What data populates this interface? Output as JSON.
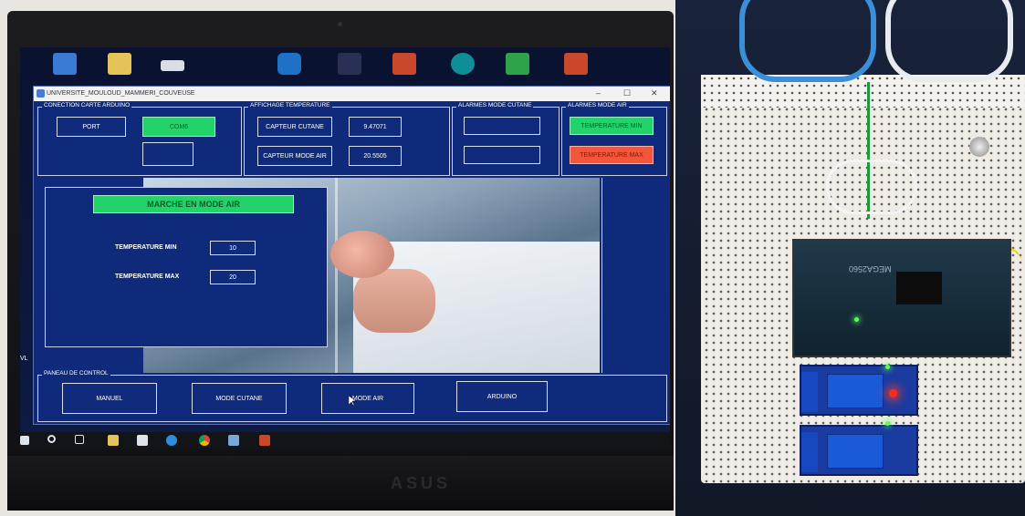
{
  "window": {
    "title": "UNIVERSITE_MOULOUD_MAMMERI_COUVEUSE",
    "minimize": "–",
    "maximize": "☐",
    "close": "✕"
  },
  "connection": {
    "group_title": "CONECTION CARTE ARDUINO",
    "port_label": "PORT",
    "port_value": "COM6",
    "status_value": ""
  },
  "temperature_display": {
    "group_title": "AFFICHAGE TEMPERATURE",
    "skin_sensor_label": "CAPTEUR CUTANE",
    "skin_sensor_value": "9.47071",
    "air_sensor_label": "CAPTEUR MODE AIR",
    "air_sensor_value": "20.5505"
  },
  "alarms_skin": {
    "group_title": "ALARMES MODE CUTANE",
    "field_1": "",
    "field_2": ""
  },
  "alarms_air": {
    "group_title": "ALARMES MODE AIR",
    "temp_min_label": "TEMPERATURE MIN",
    "temp_max_label": "TEMPERATURE MAX"
  },
  "mode_panel": {
    "banner": "MARCHE EN MODE AIR",
    "temp_min_label": "TEMPERATURE MIN",
    "temp_min_value": "10",
    "temp_max_label": "TEMPERATURE MAX",
    "temp_max_value": "20"
  },
  "control_panel": {
    "group_title": "PANEAU DE CONTROL",
    "buttons": [
      "MANUEL",
      "MODE CUTANE",
      "MODE AIR",
      "ARDUINO"
    ]
  },
  "side_label": "VL",
  "laptop_brand": "ASUS",
  "board_labels": {
    "arduino_text": "MEGA2560"
  },
  "colors": {
    "panel_blue": "#0f2a7a",
    "active_green": "#22d36a",
    "alarm_red": "#f3573b"
  }
}
